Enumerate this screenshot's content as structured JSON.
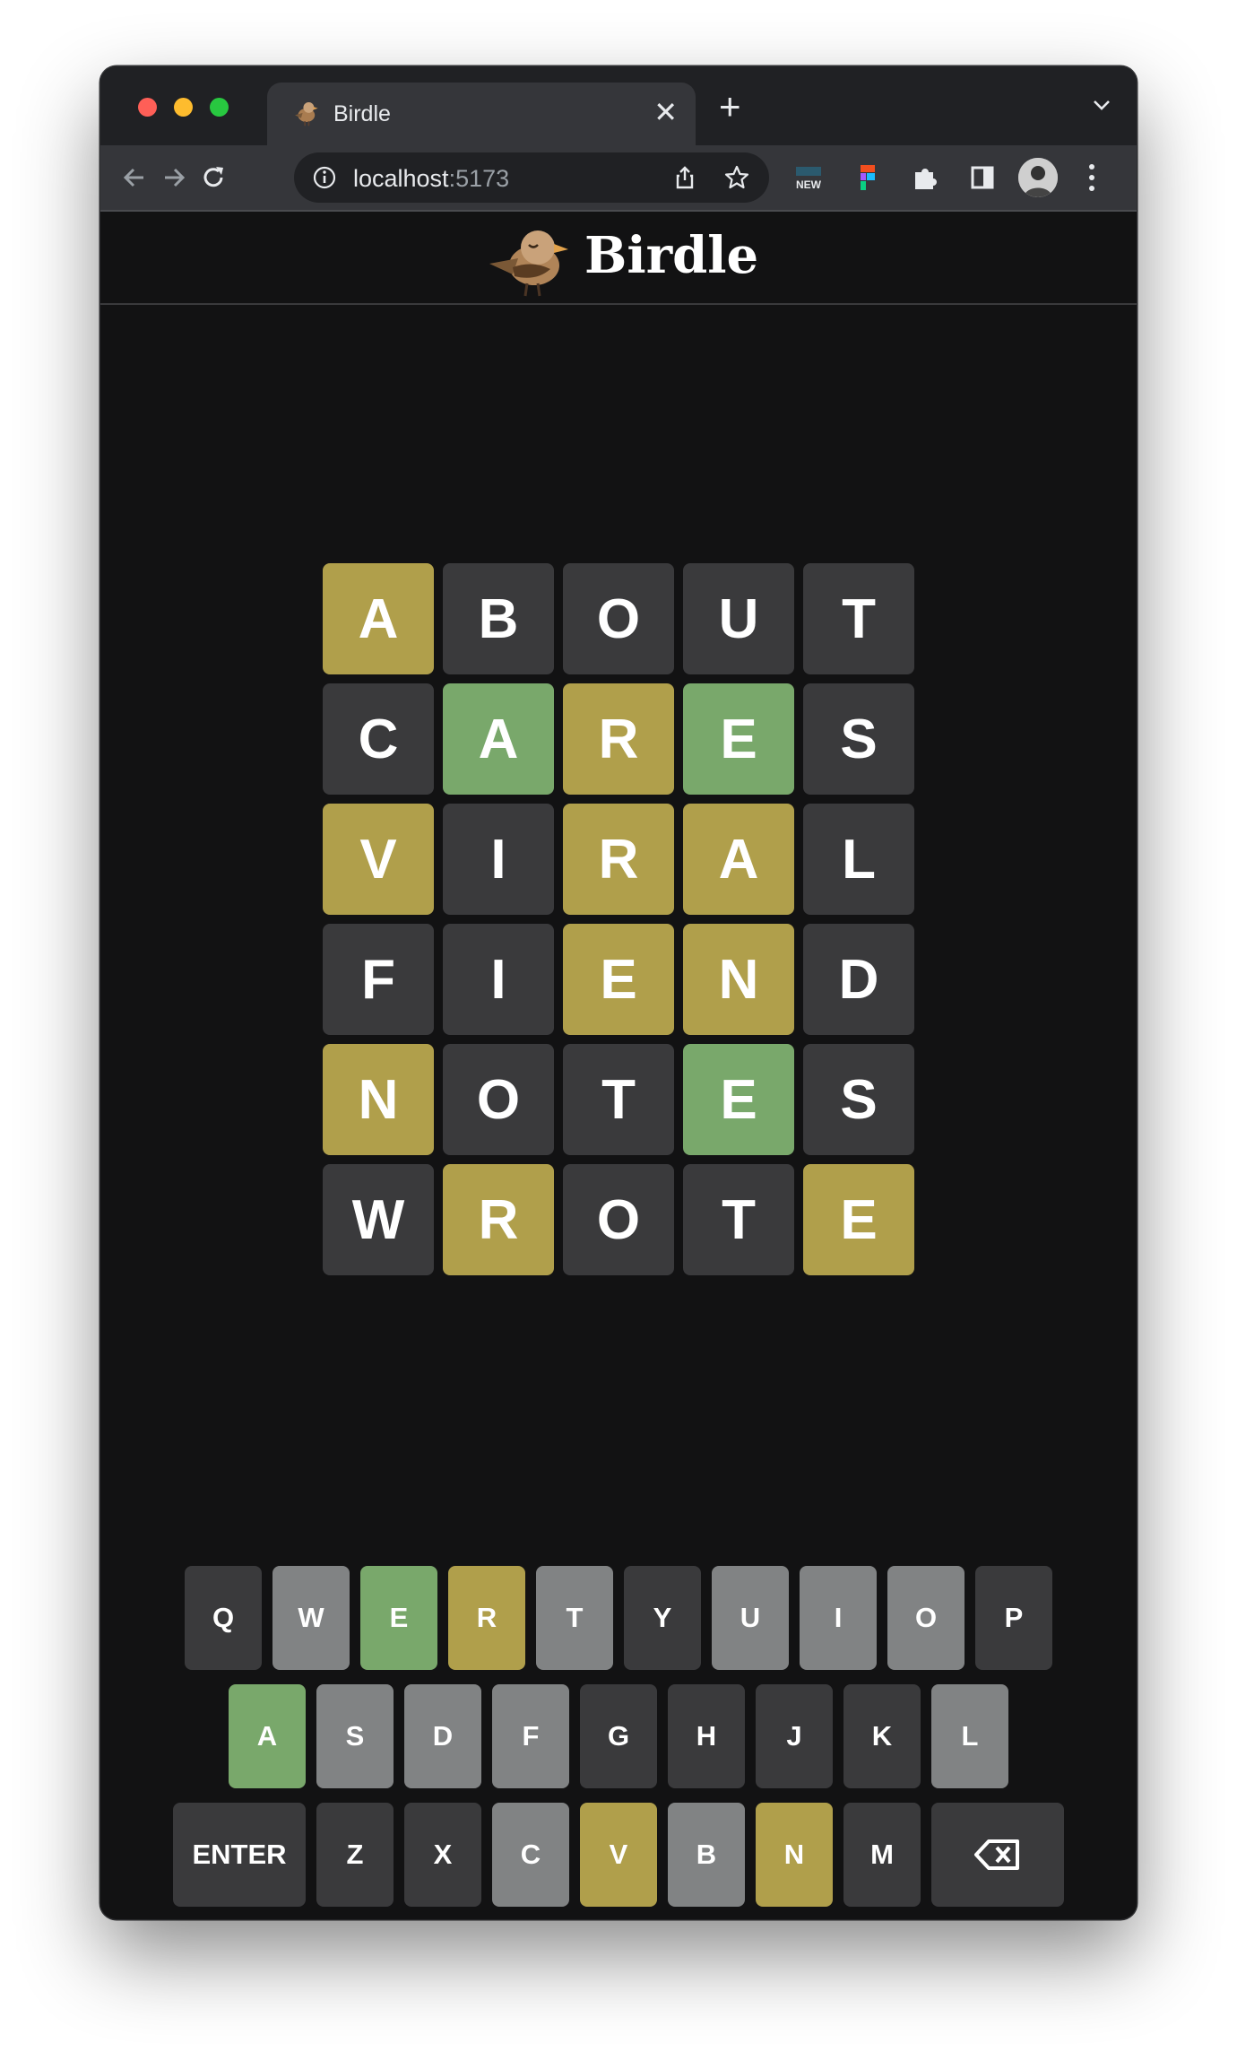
{
  "browser": {
    "tab_title": "Birdle",
    "close_glyph": "✕",
    "new_tab_glyph": "+",
    "url_host": "localhost",
    "url_port": ":5173",
    "extensions": [
      "new-badge-icon",
      "figma-icon",
      "puzzle-icon",
      "sidebar-icon"
    ]
  },
  "app": {
    "title": "Birdle"
  },
  "colors": {
    "correct": "#79a86b",
    "present": "#b09f4b",
    "absent": "#3a3a3c",
    "key_default": "#3a3a3c",
    "key_absent": "#818384"
  },
  "board": [
    [
      {
        "l": "A",
        "s": "present"
      },
      {
        "l": "B",
        "s": "absent"
      },
      {
        "l": "O",
        "s": "absent"
      },
      {
        "l": "U",
        "s": "absent"
      },
      {
        "l": "T",
        "s": "absent"
      }
    ],
    [
      {
        "l": "C",
        "s": "absent"
      },
      {
        "l": "A",
        "s": "correct"
      },
      {
        "l": "R",
        "s": "present"
      },
      {
        "l": "E",
        "s": "correct"
      },
      {
        "l": "S",
        "s": "absent"
      }
    ],
    [
      {
        "l": "V",
        "s": "present"
      },
      {
        "l": "I",
        "s": "absent"
      },
      {
        "l": "R",
        "s": "present"
      },
      {
        "l": "A",
        "s": "present"
      },
      {
        "l": "L",
        "s": "absent"
      }
    ],
    [
      {
        "l": "F",
        "s": "absent"
      },
      {
        "l": "I",
        "s": "absent"
      },
      {
        "l": "E",
        "s": "present"
      },
      {
        "l": "N",
        "s": "present"
      },
      {
        "l": "D",
        "s": "absent"
      }
    ],
    [
      {
        "l": "N",
        "s": "present"
      },
      {
        "l": "O",
        "s": "absent"
      },
      {
        "l": "T",
        "s": "absent"
      },
      {
        "l": "E",
        "s": "correct"
      },
      {
        "l": "S",
        "s": "absent"
      }
    ],
    [
      {
        "l": "W",
        "s": "absent"
      },
      {
        "l": "R",
        "s": "present"
      },
      {
        "l": "O",
        "s": "absent"
      },
      {
        "l": "T",
        "s": "absent"
      },
      {
        "l": "E",
        "s": "present"
      }
    ]
  ],
  "keyboard": [
    [
      {
        "k": "Q",
        "s": "default"
      },
      {
        "k": "W",
        "s": "used"
      },
      {
        "k": "E",
        "s": "correct"
      },
      {
        "k": "R",
        "s": "present"
      },
      {
        "k": "T",
        "s": "used"
      },
      {
        "k": "Y",
        "s": "default"
      },
      {
        "k": "U",
        "s": "used"
      },
      {
        "k": "I",
        "s": "used"
      },
      {
        "k": "O",
        "s": "used"
      },
      {
        "k": "P",
        "s": "default"
      }
    ],
    [
      {
        "k": "A",
        "s": "correct"
      },
      {
        "k": "S",
        "s": "used"
      },
      {
        "k": "D",
        "s": "used"
      },
      {
        "k": "F",
        "s": "used"
      },
      {
        "k": "G",
        "s": "default"
      },
      {
        "k": "H",
        "s": "default"
      },
      {
        "k": "J",
        "s": "default"
      },
      {
        "k": "K",
        "s": "default"
      },
      {
        "k": "L",
        "s": "used"
      }
    ],
    [
      {
        "k": "ENTER",
        "s": "default",
        "wide": true
      },
      {
        "k": "Z",
        "s": "default"
      },
      {
        "k": "X",
        "s": "default"
      },
      {
        "k": "C",
        "s": "used"
      },
      {
        "k": "V",
        "s": "present"
      },
      {
        "k": "B",
        "s": "used"
      },
      {
        "k": "N",
        "s": "present"
      },
      {
        "k": "M",
        "s": "default"
      },
      {
        "k": "",
        "s": "default",
        "wide": true,
        "icon": "backspace-icon"
      }
    ]
  ]
}
